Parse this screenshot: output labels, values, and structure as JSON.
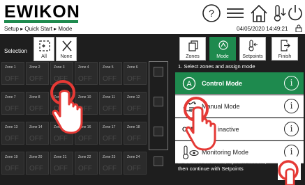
{
  "header": {
    "logo": "EWIKON",
    "breadcrumb": "Setup ▸ Quick Start ▸ Mode",
    "datetime": "04/05/2020 14:49:21"
  },
  "selection": {
    "label": "Selection",
    "all_label": "All",
    "none_label": "None"
  },
  "zones": [
    {
      "name": "Zone 1",
      "state": "OFF"
    },
    {
      "name": "Zone 2",
      "state": "OFF"
    },
    {
      "name": "Zone 3",
      "state": "OFF"
    },
    {
      "name": "Zone 4",
      "state": "OFF"
    },
    {
      "name": "Zone 5",
      "state": "OFF"
    },
    {
      "name": "Zone 6",
      "state": "OFF"
    },
    {
      "name": "Zone 7",
      "state": "OFF"
    },
    {
      "name": "Zone 8",
      "state": "OFF"
    },
    {
      "name": "Zone 9",
      "state": "OFF"
    },
    {
      "name": "Zone 10",
      "state": "OFF"
    },
    {
      "name": "Zone 11",
      "state": "OFF"
    },
    {
      "name": "Zone 12",
      "state": "OFF"
    },
    {
      "name": "Zone 13",
      "state": "OFF"
    },
    {
      "name": "Zone 14",
      "state": "OFF"
    },
    {
      "name": "Zone 15",
      "state": "OFF"
    },
    {
      "name": "Zone 16",
      "state": "OFF"
    },
    {
      "name": "Zone 17",
      "state": "OFF"
    },
    {
      "name": "Zone 18",
      "state": "OFF"
    },
    {
      "name": "Zone 19",
      "state": "OFF"
    },
    {
      "name": "Zone 20",
      "state": "OFF"
    },
    {
      "name": "Zone 21",
      "state": "OFF"
    },
    {
      "name": "Zone 22",
      "state": "OFF"
    },
    {
      "name": "Zone 23",
      "state": "OFF"
    },
    {
      "name": "Zone 24",
      "state": "OFF"
    }
  ],
  "tabs": {
    "zones": "Zones",
    "mode": "Mode",
    "setpoints": "Setpoints",
    "finish": "Finish"
  },
  "steps": {
    "step1": "1. Select zones and assign mode",
    "step2": "2. Confirm selection, repeat if needed, then continue with Setpoints"
  },
  "modes": {
    "control": "Control Mode",
    "manual": "Manual Mode",
    "zone_inactive_prefix": "OFF",
    "zone_inactive": "Zone inactive",
    "monitoring": "Monitoring Mode"
  },
  "colors": {
    "accent": "#1e8a4e",
    "panel": "#1e1e1e",
    "zone_bg": "#2b2b2b",
    "hand": "#e53935"
  }
}
